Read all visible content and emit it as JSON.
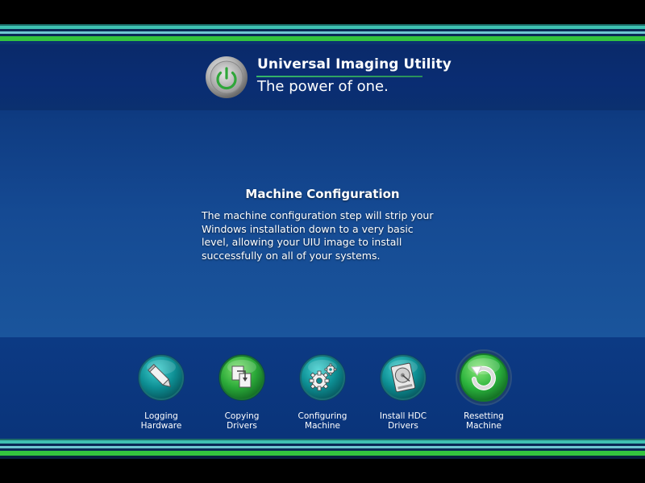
{
  "app": {
    "title": "Universal Imaging Utility",
    "tagline": "The power of one."
  },
  "section": {
    "title": "Machine Configuration",
    "body": "The machine configuration step will strip your Windows installation down to a very basic level, allowing your UIU image to install successfully on all of your systems."
  },
  "steps": [
    {
      "label": "Logging\nHardware",
      "icon": "pencil-icon",
      "active": false
    },
    {
      "label": "Copying\nDrivers",
      "icon": "copy-files-icon",
      "active": false
    },
    {
      "label": "Configuring\nMachine",
      "icon": "gears-icon",
      "active": false
    },
    {
      "label": "Install HDC\nDrivers",
      "icon": "hard-drive-icon",
      "active": false
    },
    {
      "label": "Resetting\nMachine",
      "icon": "refresh-icon",
      "active": true
    }
  ],
  "colors": {
    "teal_icon": "#0e8a8f",
    "green_icon": "#2ab24a",
    "header_blue": "#0a2d73",
    "accent_green": "#35b66a"
  }
}
